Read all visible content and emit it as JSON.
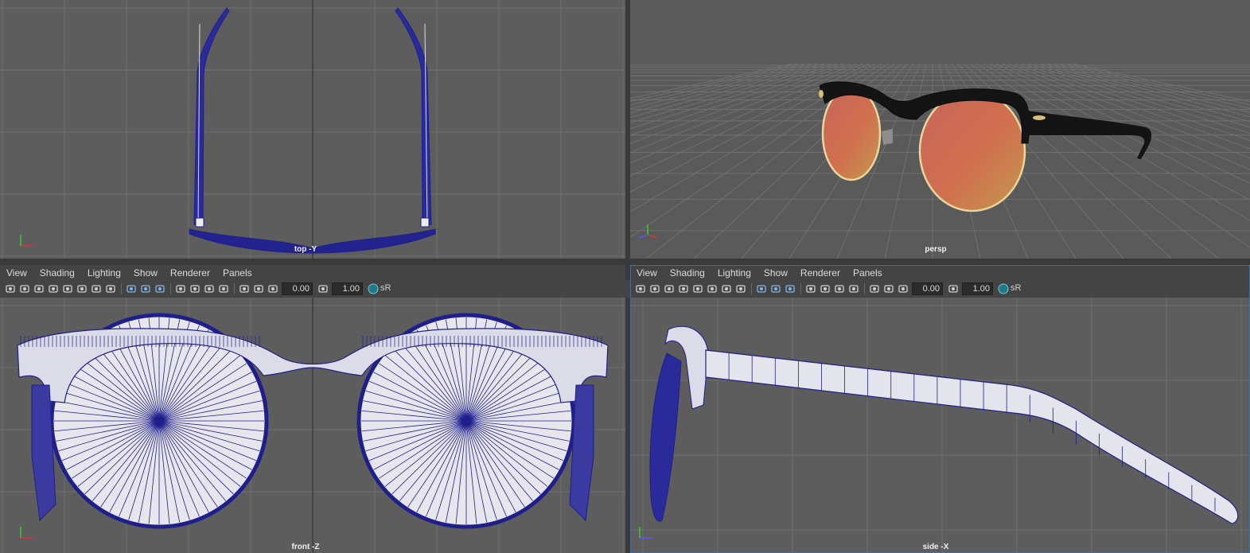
{
  "viewports": {
    "top": {
      "label": "top -Y"
    },
    "persp": {
      "label": "persp"
    },
    "front": {
      "label": "front -Z"
    },
    "side": {
      "label": "side -X"
    }
  },
  "panel_menu": [
    "View",
    "Shading",
    "Lighting",
    "Show",
    "Renderer",
    "Panels"
  ],
  "toolbar": {
    "field_a": "0.00",
    "field_b": "1.00",
    "gamma_badge": "sR"
  },
  "axis_labels": {
    "x": "x",
    "y": "y",
    "z": "z"
  },
  "colors": {
    "viewport_bg": "#5d5d5d",
    "grid": "#6e6e6e",
    "wireframe": "#1f1f8c",
    "lens_tint_a": "#d8764f",
    "lens_tint_b": "#c9a35a",
    "frame_black": "#141414",
    "rim_gold": "#e8d79a"
  },
  "icons": [
    "camera-icon",
    "lock-camera-icon",
    "bookmark-icon",
    "image-plane-icon",
    "grid-icon",
    "film-gate-icon",
    "resolution-gate-icon",
    "safe-action-icon",
    "wireframe-icon",
    "smooth-shade-icon",
    "textured-icon",
    "lights-icon",
    "shadows-icon",
    "ambient-occlusion-icon",
    "isolate-select-icon",
    "xray-icon",
    "exposure-icon",
    "gamma-icon",
    "color-management-icon"
  ]
}
